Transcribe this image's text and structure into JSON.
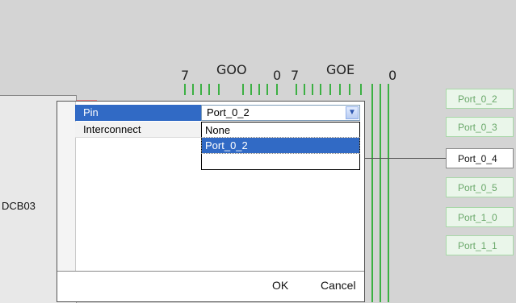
{
  "bus": {
    "goo_label": "GOO",
    "goe_label": "GOE",
    "goo_high": "7",
    "goo_low": "0",
    "goe_high": "7",
    "goe_low": "0"
  },
  "block": {
    "label": "DCB03"
  },
  "ports": [
    "Port_0_2",
    "Port_0_3",
    "Port_0_4",
    "Port_0_5",
    "Port_1_0",
    "Port_1_1"
  ],
  "dialog": {
    "pin_label": "Pin",
    "interconnect_label": "Interconnect",
    "pin_value": "Port_0_2",
    "options": [
      "None",
      "Port_0_2"
    ],
    "selected_option": "Port_0_2",
    "ok_label": "OK",
    "cancel_label": "Cancel"
  },
  "colors": {
    "bus_green": "#3cb043",
    "selection_blue": "#316ac5",
    "wire_red": "#e04040",
    "wire_purple": "#7030a0"
  }
}
